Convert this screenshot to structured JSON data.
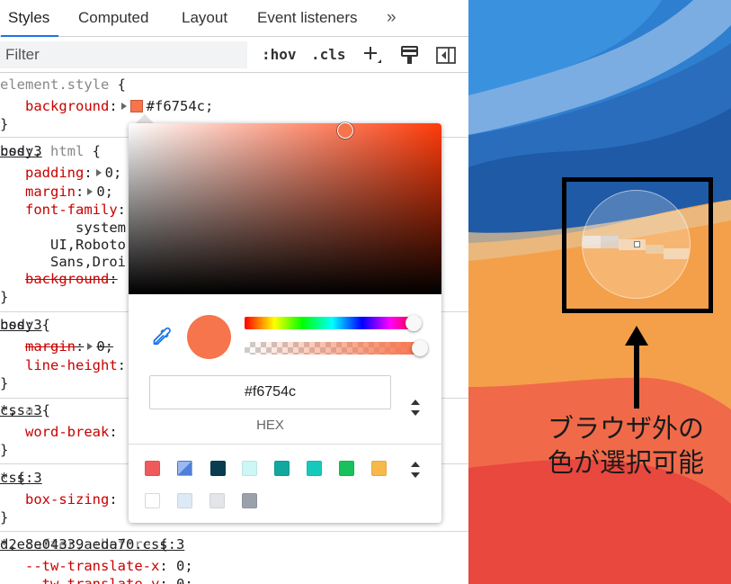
{
  "tabs": [
    {
      "label": "Styles",
      "active": true
    },
    {
      "label": "Computed",
      "active": false
    },
    {
      "label": "Layout",
      "active": false
    },
    {
      "label": "Event listeners",
      "active": false
    }
  ],
  "more_tabs_icon": "»",
  "toolbar": {
    "filter_placeholder": "Filter",
    "hov_label": ":hov",
    "cls_label": ".cls",
    "add_rule_icon": "plus-icon",
    "paint_icon": "paint-brush-icon",
    "sidebar_toggle_icon": "toggle-sidebar-icon"
  },
  "rules": {
    "element_style": {
      "selector": "element.style",
      "open": " {",
      "prop": "background",
      "value": "#f6754c;",
      "close": "}"
    },
    "body_html": {
      "selector": "body, ",
      "selector_muted": "html",
      "open": " {",
      "source": "css:3",
      "padding": {
        "prop": "padding",
        "value": "0;"
      },
      "margin": {
        "prop": "margin",
        "value": "0;"
      },
      "font_family": {
        "prop": "font-family",
        "cont1": "system",
        "cont2": "UI,Roboto",
        "cont3": "Sans,Droi"
      },
      "background": {
        "prop": "background"
      },
      "close": "}"
    },
    "body": {
      "selector": "body",
      "open": " {",
      "source": "css:3",
      "margin": {
        "prop": "margin",
        "value": "0;"
      },
      "line_height": {
        "prop": "line-height"
      },
      "close": "}"
    },
    "star_a": {
      "selector": "*, ",
      "selector_muted": "a",
      "open": " {",
      "source": "css:3",
      "word_break": {
        "prop": "word-break"
      },
      "close": "}"
    },
    "star": {
      "selector": "*",
      "open": " {",
      "source": "css:3",
      "box_sizing": {
        "prop": "box-sizing"
      },
      "close": "}"
    },
    "star_after": {
      "selector": "*, ",
      "selector_muted": ":after, :before",
      "open": " {",
      "source": "d2e8e04339aeda70.css:3",
      "tw_x": {
        "prop": "--tw-translate-x",
        "value": "0;"
      },
      "tw_y": {
        "prop": "--tw-translate-y",
        "value": "0;"
      }
    }
  },
  "picker": {
    "hex_value": "#f6754c",
    "format_label": "HEX",
    "current_color": "#f6754c",
    "palette": [
      "#f05a5a",
      "#6d9be8",
      "#083d4f",
      "#ccf7f7",
      "#12a8a0",
      "#16c9bd",
      "#17c25a",
      "#f7b94a",
      "#ffffff",
      "#dde9f6",
      "#e3e5e8",
      "#9ba1ab"
    ]
  },
  "annotation": {
    "caption_line1": "ブラウザ外の",
    "caption_line2": "色が選択可能"
  }
}
